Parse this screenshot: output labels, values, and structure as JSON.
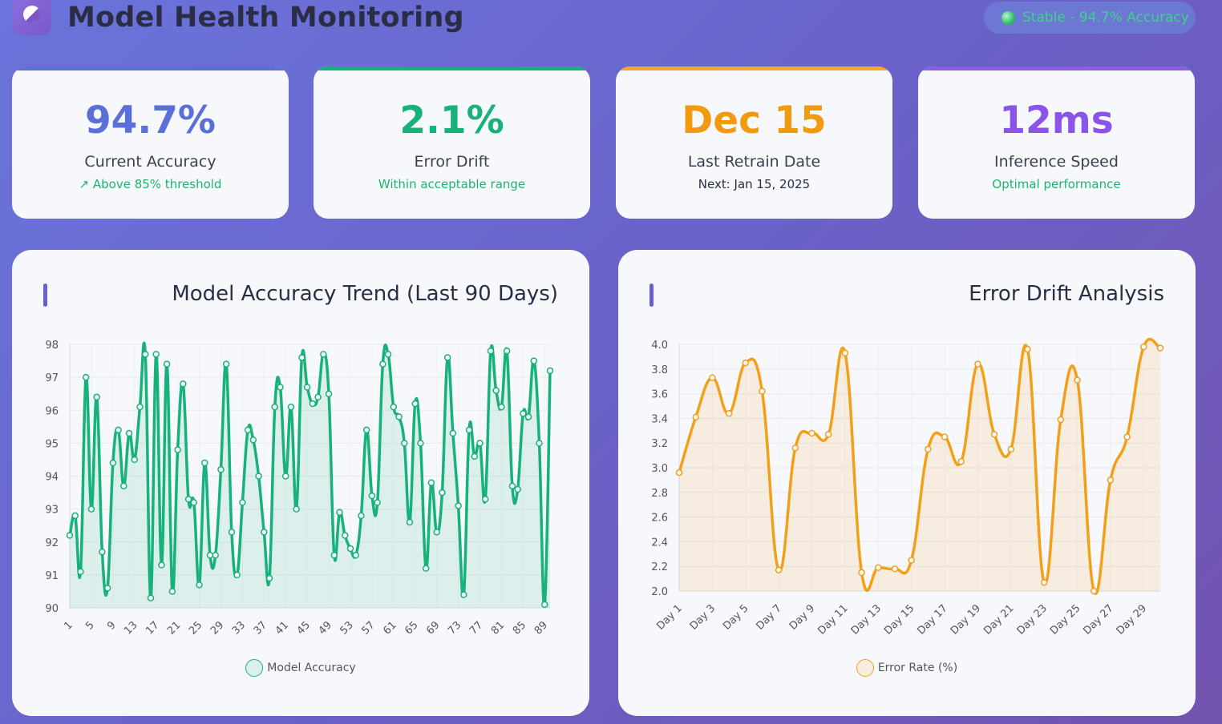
{
  "header": {
    "title": "Model Health Monitoring",
    "status_text": "Stable - 94.7% Accuracy",
    "logo_icon": "half-circle-logo-icon"
  },
  "cards": [
    {
      "value": "94.7%",
      "label": "Current Accuracy",
      "sub": "↗ Above 85% threshold",
      "color": "#5b6fd8",
      "sub_color": "#1db36f",
      "bar": "#5b6fd8"
    },
    {
      "value": "2.1%",
      "label": "Error Drift",
      "sub": "Within acceptable range",
      "color": "#17b27a",
      "sub_color": "#1db36f",
      "bar": "#17b27a"
    },
    {
      "value": "Dec 15",
      "label": "Last Retrain Date",
      "sub": "Next: Jan 15, 2025",
      "color": "#f19a0f",
      "sub_color": "#2b2d45",
      "bar": "#f5a623"
    },
    {
      "value": "12ms",
      "label": "Inference Speed",
      "sub": "Optimal performance",
      "color": "#8a54e8",
      "sub_color": "#1db36f",
      "bar": "#8a5ce8"
    }
  ],
  "chart_data": [
    {
      "type": "line",
      "title": "Model Accuracy Trend (Last 90 Days)",
      "color": "#17b27a",
      "fill": "rgba(23,178,122,0.12)",
      "x": [
        1,
        2,
        3,
        4,
        5,
        6,
        7,
        8,
        9,
        10,
        11,
        12,
        13,
        14,
        15,
        16,
        17,
        18,
        19,
        20,
        21,
        22,
        23,
        24,
        25,
        26,
        27,
        28,
        29,
        30,
        31,
        32,
        33,
        34,
        35,
        36,
        37,
        38,
        39,
        40,
        41,
        42,
        43,
        44,
        45,
        46,
        47,
        48,
        49,
        50,
        51,
        52,
        53,
        54,
        55,
        56,
        57,
        58,
        59,
        60,
        61,
        62,
        63,
        64,
        65,
        66,
        67,
        68,
        69,
        70,
        71,
        72,
        73,
        74,
        75,
        76,
        77,
        78,
        79,
        80,
        81,
        82,
        83,
        84,
        85,
        86,
        87,
        88,
        89,
        90
      ],
      "xtick_labels": [
        "1",
        "5",
        "9",
        "13",
        "17",
        "21",
        "25",
        "29",
        "33",
        "37",
        "41",
        "45",
        "49",
        "53",
        "57",
        "61",
        "65",
        "69",
        "73",
        "77",
        "81",
        "85",
        "89"
      ],
      "ylim": [
        90,
        98
      ],
      "yticks": [
        90,
        91,
        92,
        93,
        94,
        95,
        96,
        97,
        98
      ],
      "series": [
        {
          "name": "Model Accuracy",
          "values": [
            92.2,
            92.8,
            91.1,
            97.0,
            93.0,
            96.4,
            91.7,
            90.6,
            94.4,
            95.4,
            93.7,
            95.3,
            94.5,
            96.1,
            97.7,
            90.3,
            97.7,
            91.3,
            97.4,
            90.5,
            94.8,
            96.8,
            93.3,
            93.2,
            90.7,
            94.4,
            91.6,
            91.6,
            94.2,
            97.4,
            92.3,
            91.0,
            93.2,
            95.4,
            95.1,
            94.0,
            92.3,
            90.9,
            96.1,
            96.7,
            94.0,
            96.1,
            93.0,
            97.6,
            96.7,
            96.2,
            96.4,
            97.7,
            96.5,
            91.6,
            92.9,
            92.2,
            91.8,
            91.6,
            92.8,
            95.4,
            93.4,
            93.2,
            97.4,
            97.7,
            96.1,
            95.8,
            95.0,
            92.6,
            96.2,
            95.0,
            91.2,
            93.8,
            92.3,
            93.5,
            97.6,
            95.3,
            93.1,
            90.4,
            95.4,
            94.6,
            95.0,
            93.3,
            97.8,
            96.6,
            96.1,
            97.8,
            93.7,
            93.6,
            95.9,
            95.8,
            97.5,
            95.0,
            90.1,
            97.2
          ]
        }
      ]
    },
    {
      "type": "line",
      "title": "Error Drift Analysis",
      "color": "#f2a01a",
      "fill": "rgba(242,160,26,0.12)",
      "categories": [
        "Day 1",
        "Day 2",
        "Day 3",
        "Day 4",
        "Day 5",
        "Day 6",
        "Day 7",
        "Day 8",
        "Day 9",
        "Day 10",
        "Day 11",
        "Day 12",
        "Day 13",
        "Day 14",
        "Day 15",
        "Day 16",
        "Day 17",
        "Day 18",
        "Day 19",
        "Day 20",
        "Day 21",
        "Day 22",
        "Day 23",
        "Day 24",
        "Day 25",
        "Day 26",
        "Day 27",
        "Day 28",
        "Day 29",
        "Day 30"
      ],
      "xtick_labels": [
        "Day 1",
        "Day 3",
        "Day 5",
        "Day 7",
        "Day 9",
        "Day 11",
        "Day 13",
        "Day 15",
        "Day 17",
        "Day 19",
        "Day 21",
        "Day 23",
        "Day 25",
        "Day 27",
        "Day 29"
      ],
      "ylim": [
        2.0,
        4.0
      ],
      "yticks": [
        "2.0",
        "2.2",
        "2.4",
        "2.6",
        "2.8",
        "3.0",
        "3.2",
        "3.4",
        "3.6",
        "3.8",
        "4.0"
      ],
      "series": [
        {
          "name": "Error Rate (%)",
          "values": [
            2.96,
            3.41,
            3.73,
            3.44,
            3.85,
            3.62,
            2.17,
            3.16,
            3.28,
            3.27,
            3.93,
            2.15,
            2.19,
            2.18,
            2.25,
            3.15,
            3.25,
            3.05,
            3.84,
            3.27,
            3.15,
            3.96,
            2.07,
            3.39,
            3.71,
            2.0,
            2.9,
            3.25,
            3.98,
            3.97
          ]
        }
      ]
    }
  ]
}
